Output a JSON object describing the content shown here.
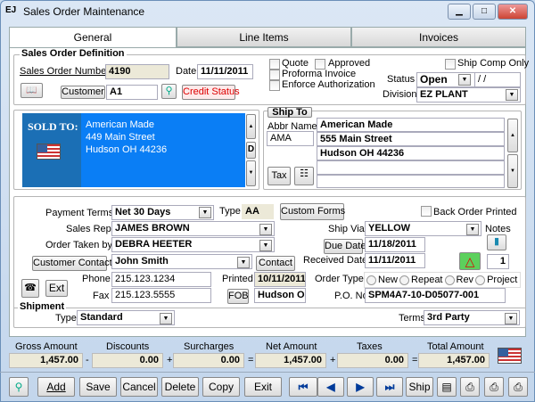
{
  "window": {
    "title": "Sales Order Maintenance",
    "logo": "EJ"
  },
  "tabs": [
    "General",
    "Line Items",
    "Invoices"
  ],
  "definition": {
    "group": "Sales Order Definition",
    "so_number_label": "Sales Order Number",
    "so_number": "4190",
    "date_label": "Date",
    "date": "11/11/2011",
    "customer_label": "Customer",
    "customer": "A1",
    "credit_status": "Credit Status",
    "quote": "Quote",
    "approved": "Approved",
    "proforma": "Proforma Invoice",
    "enforce": "Enforce Authorization",
    "ship_comp_only": "Ship Comp Only",
    "status_label": "Status",
    "status": "Open",
    "status_date": " / /",
    "division_label": "Division",
    "division": "EZ PLANT"
  },
  "sold_to": {
    "label": "SOLD TO:",
    "lines": [
      "American Made",
      "449 Main Street",
      "Hudson  OH 44236"
    ],
    "d_button": "D"
  },
  "ship_to": {
    "label": "Ship To",
    "abbr_label": "Abbr Name",
    "abbr": "AMA",
    "lines": [
      "American Made",
      "555 Main Street",
      "Hudson  OH 44236",
      "",
      ""
    ],
    "tax": "Tax"
  },
  "order": {
    "payment_terms_label": "Payment Terms",
    "payment_terms": "Net 30 Days",
    "type_label": "Type",
    "type": "AA",
    "custom_forms": "Custom Forms",
    "back_order_printed": "Back Order Printed",
    "sales_rep_label": "Sales Rep",
    "sales_rep": "JAMES BROWN",
    "ship_via_label": "Ship Via",
    "ship_via": "YELLOW",
    "notes_label": "Notes",
    "order_taken_label": "Order Taken by",
    "order_taken": "DEBRA HEETER",
    "due_date_button": "Due Date",
    "due_date": "11/18/2011",
    "customer_contact_button": "Customer Contact",
    "contact": "John Smith",
    "contact_button": "Contact",
    "received_label": "Received Date",
    "received": "11/11/2011",
    "count": "1",
    "phone_label": "Phone",
    "phone": "215.123.1234",
    "printed_label": "Printed",
    "printed": "10/11/2011",
    "order_type_label": "Order Type",
    "order_types": [
      "New",
      "Repeat",
      "Rev",
      "Project"
    ],
    "ext": "Ext",
    "fax_label": "Fax",
    "fax": "215.123.5555",
    "fob_button": "FOB",
    "fob": "Hudson OH",
    "po_label": "P.O. No",
    "po": "SPM4A7-10-D05077-001"
  },
  "shipment": {
    "group": "Shipment",
    "type_label": "Type",
    "type": "Standard",
    "terms_label": "Terms",
    "terms": "3rd Party"
  },
  "totals": {
    "labels": [
      "Gross Amount",
      "Discounts",
      "Surcharges",
      "Net Amount",
      "Taxes",
      "Total Amount"
    ],
    "values": [
      "1,457.00",
      "0.00",
      "0.00",
      "1,457.00",
      "0.00",
      "1,457.00"
    ],
    "ops": [
      "-",
      "+",
      "=",
      "+",
      "="
    ]
  },
  "toolbar": {
    "add": "Add",
    "save": "Save",
    "cancel": "Cancel",
    "delete": "Delete",
    "copy": "Copy",
    "exit": "Exit",
    "ship": "Ship"
  }
}
